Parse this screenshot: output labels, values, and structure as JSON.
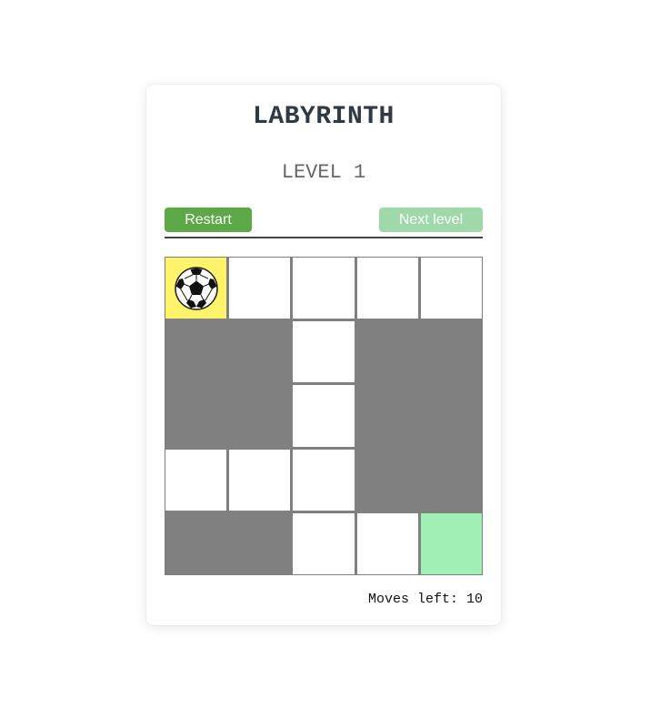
{
  "game": {
    "title": "LABYRINTH",
    "level_label": "LEVEL 1",
    "restart_label": "Restart",
    "next_level_label": "Next level",
    "next_level_enabled": false,
    "moves_label": "Moves left:",
    "moves_left": "10"
  },
  "colors": {
    "wall": "#808080",
    "open": "#ffffff",
    "current": "#fff36a",
    "goal": "#a0efb5",
    "restart_button": "#5da847",
    "next_button_disabled": "#9fd8a9"
  },
  "maze": {
    "rows": [
      [
        "start",
        "open",
        "open",
        "open",
        "open"
      ],
      [
        "wall",
        "wall",
        "open",
        "wall",
        "wall"
      ],
      [
        "wall",
        "wall",
        "open",
        "wall",
        "wall"
      ],
      [
        "open",
        "open",
        "open",
        "wall",
        "wall"
      ],
      [
        "wall",
        "wall",
        "open",
        "open",
        "goal"
      ]
    ],
    "player_icon": "soccer-ball-icon"
  }
}
